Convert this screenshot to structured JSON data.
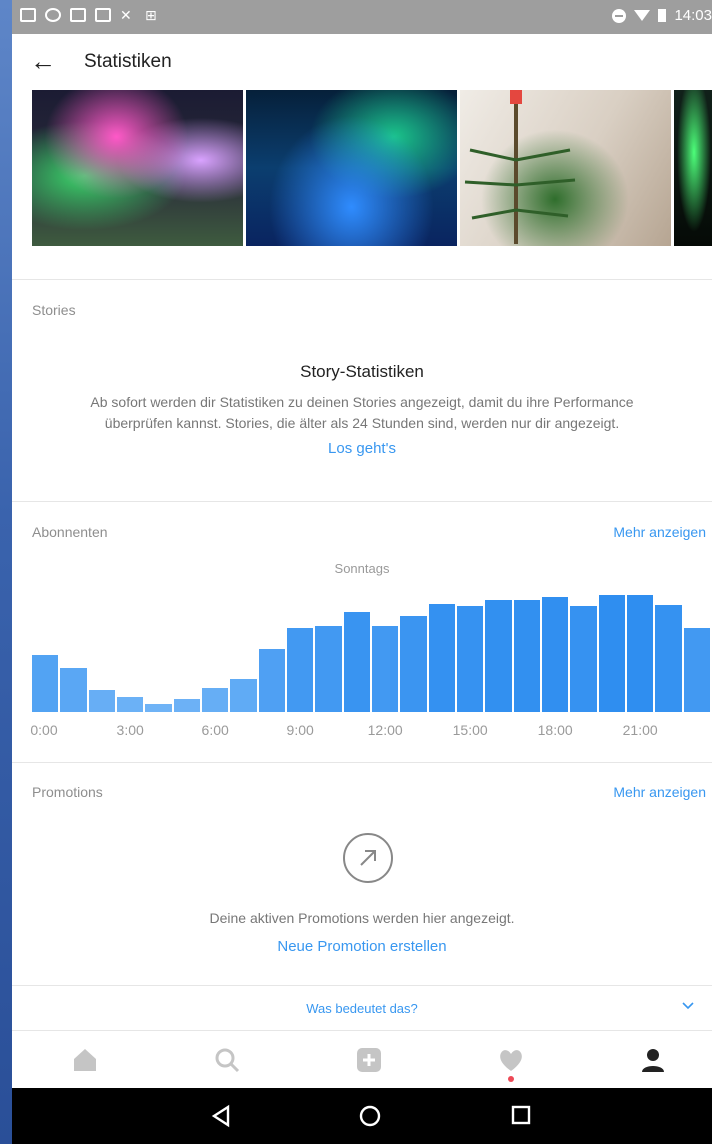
{
  "status_bar": {
    "time": "14:03"
  },
  "header": {
    "title": "Statistiken"
  },
  "stories": {
    "section_label": "Stories",
    "title": "Story-Statistiken",
    "description_line1": "Ab sofort werden dir Statistiken zu deinen Stories angezeigt, damit du ihre Performance",
    "description_line2": "überprüfen kannst. Stories, die älter als 24 Stunden sind, werden nur dir angezeigt.",
    "cta": "Los geht's"
  },
  "followers": {
    "section_label": "Abonnenten",
    "more_label": "Mehr anzeigen",
    "chart_caption": "Sonntags"
  },
  "chart_data": {
    "type": "bar",
    "title": "Sonntags",
    "categories": [
      "0:00",
      "1:00",
      "2:00",
      "3:00",
      "4:00",
      "5:00",
      "6:00",
      "7:00",
      "8:00",
      "9:00",
      "10:00",
      "11:00",
      "12:00",
      "13:00",
      "14:00",
      "15:00",
      "16:00",
      "17:00",
      "18:00",
      "19:00",
      "20:00",
      "21:00",
      "22:00",
      "23:00"
    ],
    "values": [
      43,
      33,
      17,
      11,
      6,
      10,
      18,
      25,
      48,
      64,
      65,
      76,
      65,
      73,
      82,
      80,
      85,
      85,
      87,
      80,
      89,
      89,
      81,
      64
    ],
    "tick_labels": [
      "0:00",
      "3:00",
      "6:00",
      "9:00",
      "12:00",
      "15:00",
      "18:00",
      "21:00"
    ],
    "ylim": [
      0,
      100
    ],
    "grid": false,
    "colors": {
      "low": "#6fb3f6",
      "high": "#2f8ef0"
    }
  },
  "promotions": {
    "section_label": "Promotions",
    "more_label": "Mehr anzeigen",
    "icon": "arrow-up-right-icon",
    "message": "Deine aktiven Promotions werden hier angezeigt.",
    "cta": "Neue Promotion erstellen"
  },
  "info": {
    "label": "Was bedeutet das?"
  },
  "nav": {
    "items": [
      "home-icon",
      "search-icon",
      "add-icon",
      "heart-icon",
      "profile-icon"
    ]
  },
  "colors": {
    "link": "#3897f0",
    "bar": "#5aa6f4"
  }
}
